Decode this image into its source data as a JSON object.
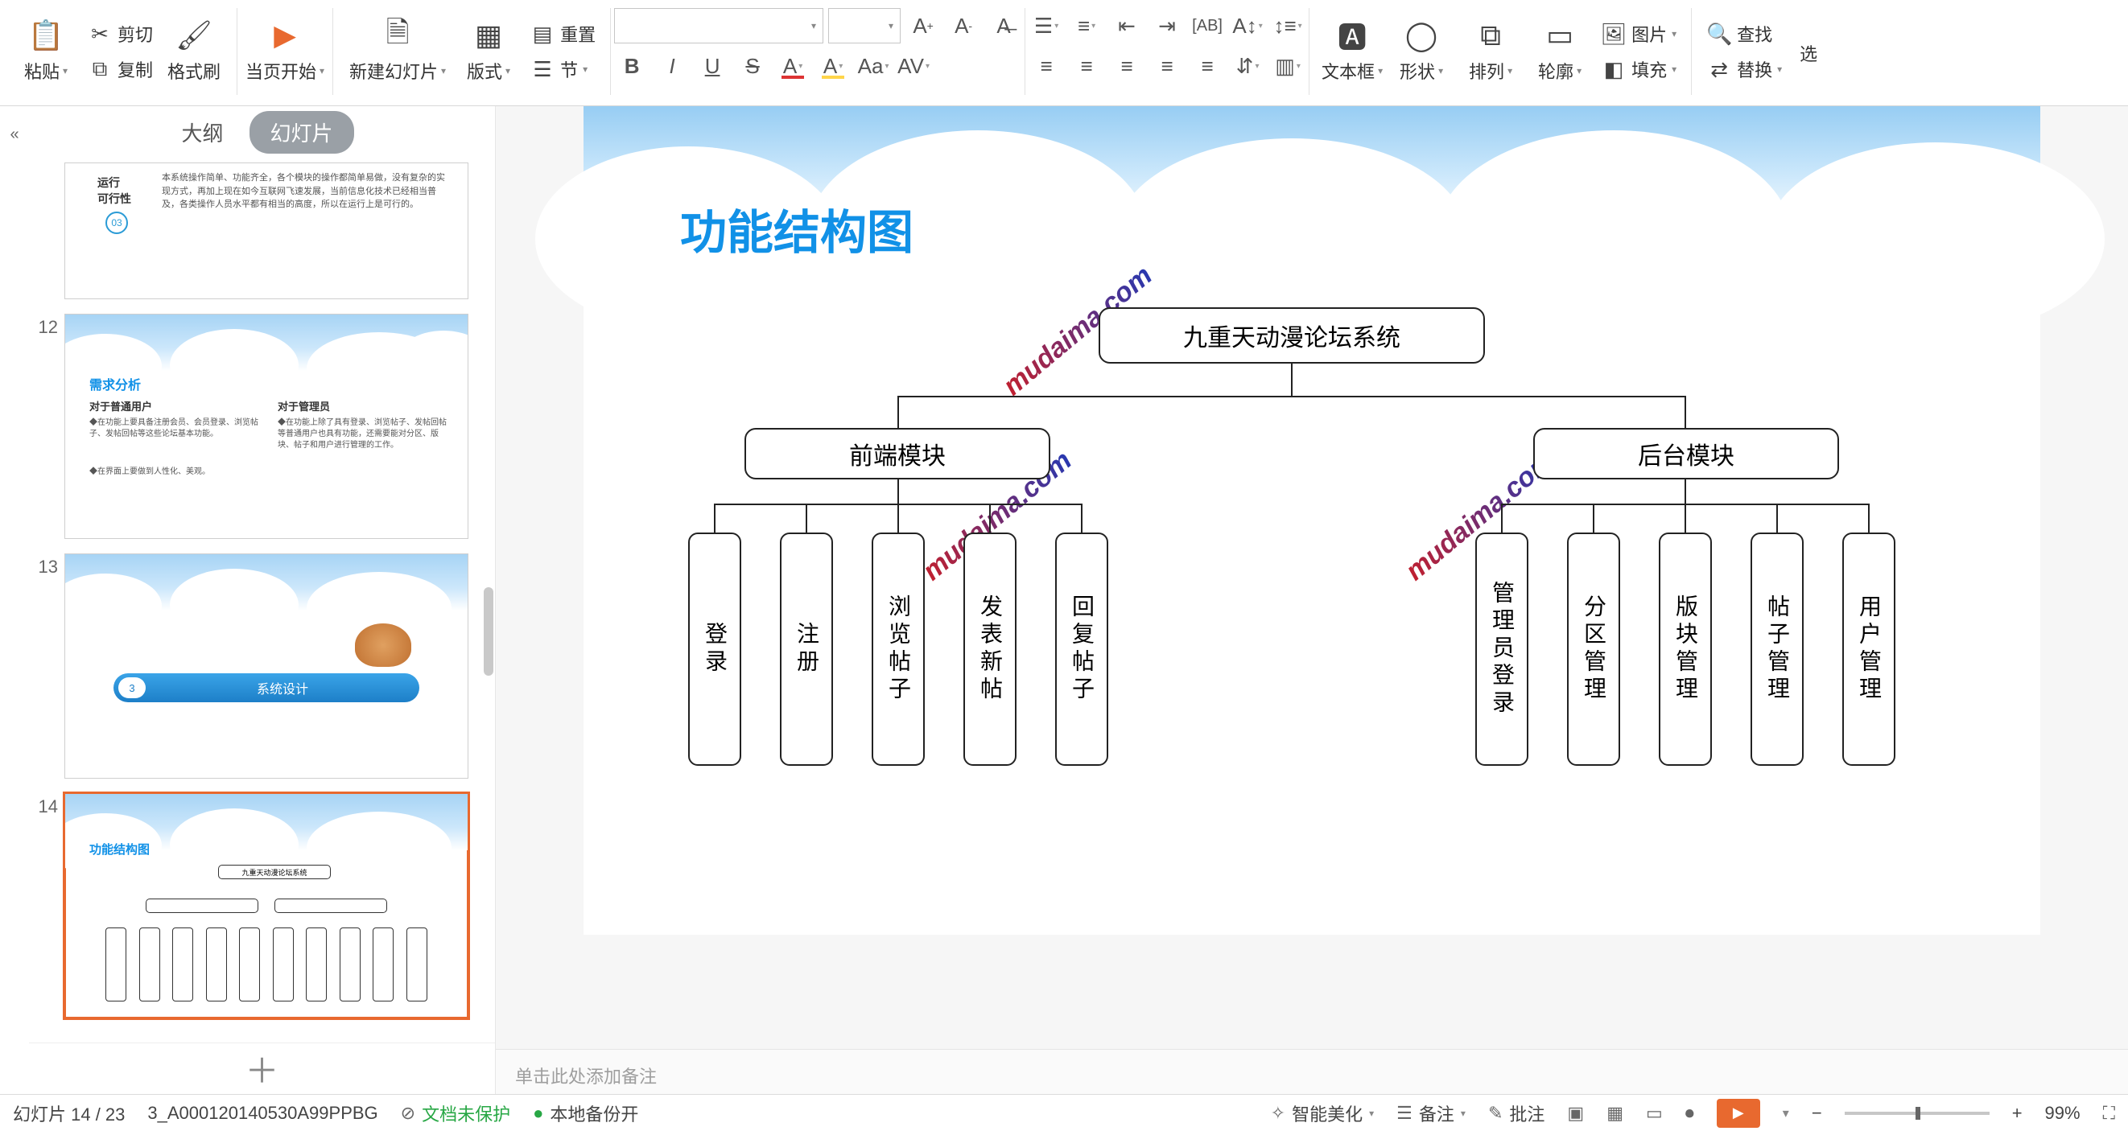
{
  "ribbon": {
    "paste": "粘贴",
    "cut": "剪切",
    "copy": "复制",
    "format_painter": "格式刷",
    "from_current": "当页开始",
    "new_slide": "新建幻灯片",
    "layout": "版式",
    "section": "节",
    "reset": "重置",
    "bold": "B",
    "italic": "I",
    "underline": "U",
    "strike": "S",
    "textbox": "文本框",
    "shape": "形状",
    "arrange": "排列",
    "outline": "轮廓",
    "picture": "图片",
    "fill": "填充",
    "find": "查找",
    "replace": "替换",
    "select": "选"
  },
  "left": {
    "tab_outline": "大纲",
    "tab_slides": "幻灯片",
    "num12": "12",
    "num13": "13",
    "num14": "14",
    "t11a": "运行",
    "t11b": "可行性",
    "t11c": "03",
    "t11d": "本系统操作简单、功能齐全，各个模块的操作都简单易做，没有复杂的实现方式，再加上现在如今互联网飞速发展，当前信息化技术已经相当普及，各类操作人员水平都有相当的高度，所以在运行上是可行的。",
    "t12a": "需求分析",
    "t12b": "对于普通用户",
    "t12c": "对于管理员",
    "t12d": "在功能上要具备注册会员、会员登录、浏览帖子、发帖回帖等这些论坛基本功能。",
    "t12e": "在界面上要做到人性化、美观。",
    "t12f": "在功能上除了具有登录、浏览帖子、发帖回帖等普通用户也具有功能，还需要能对分区、版块、帖子和用户进行管理的工作。",
    "t13a": "系统设计",
    "t13b": "3",
    "t14a": "功能结构图"
  },
  "slide": {
    "title": "功能结构图",
    "watermark": "mudaima.com",
    "root": "九重天动漫论坛系统",
    "front": "前端模块",
    "back": "后台模块",
    "f1": "登录",
    "f2": "注册",
    "f3": "浏览帖子",
    "f4": "发表新帖",
    "f5": "回复帖子",
    "b1": "管理员登录",
    "b2": "分区管理",
    "b3": "版块管理",
    "b4": "帖子管理",
    "b5": "用户管理"
  },
  "notes": "单击此处添加备注",
  "status": {
    "page": "幻灯片 14 / 23",
    "file": "3_A000120140530A99PPBG",
    "protect": "文档未保护",
    "backup": "本地备份开",
    "beautify": "智能美化",
    "notes": "备注",
    "comment": "批注",
    "zoom": "99%"
  }
}
